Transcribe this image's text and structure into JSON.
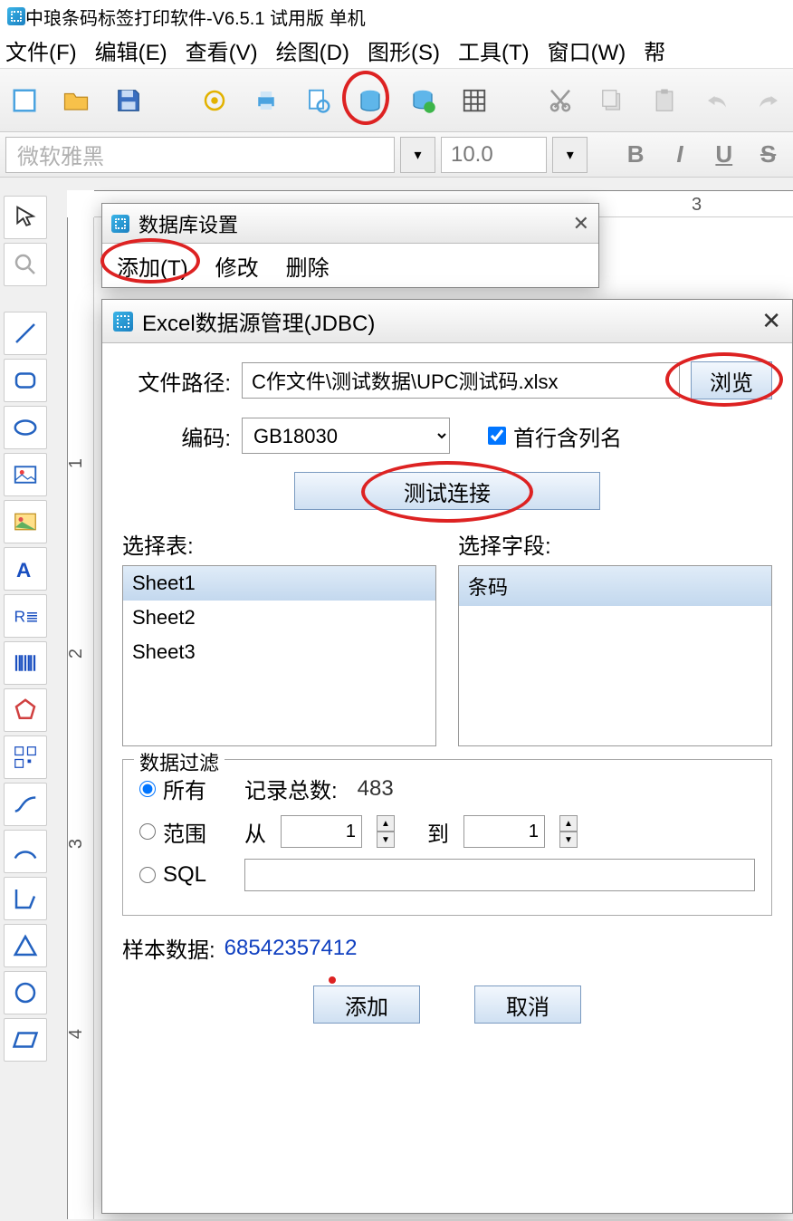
{
  "app": {
    "title": "中琅条码标签打印软件-V6.5.1 试用版 单机"
  },
  "menu": {
    "file": "文件(F)",
    "edit": "编辑(E)",
    "view": "查看(V)",
    "draw": "绘图(D)",
    "shape": "图形(S)",
    "tools": "工具(T)",
    "window": "窗口(W)",
    "help": "帮"
  },
  "fontbar": {
    "fontname": "微软雅黑",
    "fontsize": "10.0",
    "b": "B",
    "i": "I",
    "u": "U",
    "s": "S"
  },
  "ruler": {
    "t0": "3",
    "l0": "1",
    "l1": "2",
    "l2": "3",
    "l3": "4"
  },
  "dlg_db": {
    "title": "数据库设置",
    "add": "添加(T)",
    "modify": "修改",
    "delete": "删除"
  },
  "dlg_excel": {
    "title": "Excel数据源管理(JDBC)",
    "path_label": "文件路径:",
    "path_value": "C作文件\\测试数据\\UPC测试码.xlsx",
    "browse": "浏览",
    "enc_label": "编码:",
    "enc_value": "GB18030",
    "firstrow": "首行含列名",
    "test": "测试连接",
    "select_table": "选择表:",
    "select_field": "选择字段:",
    "sheets": [
      "Sheet1",
      "Sheet2",
      "Sheet3"
    ],
    "fields": [
      "条码"
    ],
    "filter_legend": "数据过滤",
    "all": "所有",
    "range": "范围",
    "sql": "SQL",
    "total_lbl": "记录总数:",
    "total_val": "483",
    "from": "从",
    "to": "到",
    "from_val": "1",
    "to_val": "1",
    "sample_lbl": "样本数据:",
    "sample_val": "68542357412",
    "ok": "添加",
    "cancel": "取消"
  }
}
